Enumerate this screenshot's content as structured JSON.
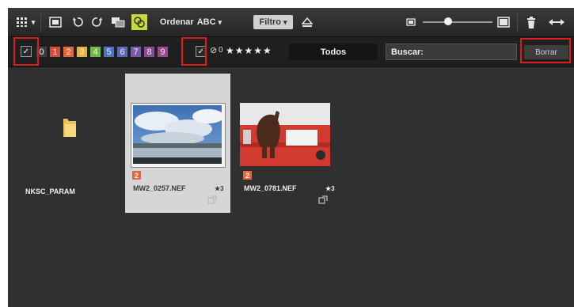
{
  "toolbar": {
    "grid_view_icon": "grid-icon",
    "sort_label": "Ordenar",
    "sort_value": "ABC",
    "filter_label": "Filtro",
    "dropdown_glyph": "▾"
  },
  "filterbar": {
    "labels_checkbox_mark": "✓",
    "label_numbers": [
      "0",
      "1",
      "2",
      "3",
      "4",
      "5",
      "6",
      "7",
      "8",
      "9"
    ],
    "label_colors": [
      "#3d3d3d",
      "#d94a3c",
      "#e8643a",
      "#e6b43c",
      "#6fb84a",
      "#4a74c2",
      "#5a6ab8",
      "#7a5aa8",
      "#8a4a9a",
      "#9a4a8a"
    ],
    "rating_checkbox_mark": "✓",
    "rating_reject_glyph": "⊘",
    "rating_zero": "0",
    "stars": "★★★★★",
    "all_button": "Todos",
    "search_label": "Buscar:",
    "search_placeholder": "",
    "clear_button": "Borrar"
  },
  "browser": {
    "items": [
      {
        "type": "folder",
        "name": "NKSC_PARAM"
      },
      {
        "type": "image",
        "name": "MW2_0257.NEF",
        "label_badge": "2",
        "rating": "★3",
        "selected": true
      },
      {
        "type": "image",
        "name": "MW2_0781.NEF",
        "label_badge": "2",
        "rating": "★3",
        "selected": false
      }
    ]
  },
  "colors": {
    "highlight_red": "#e01b1b",
    "label_2_orange": "#e8643a"
  }
}
